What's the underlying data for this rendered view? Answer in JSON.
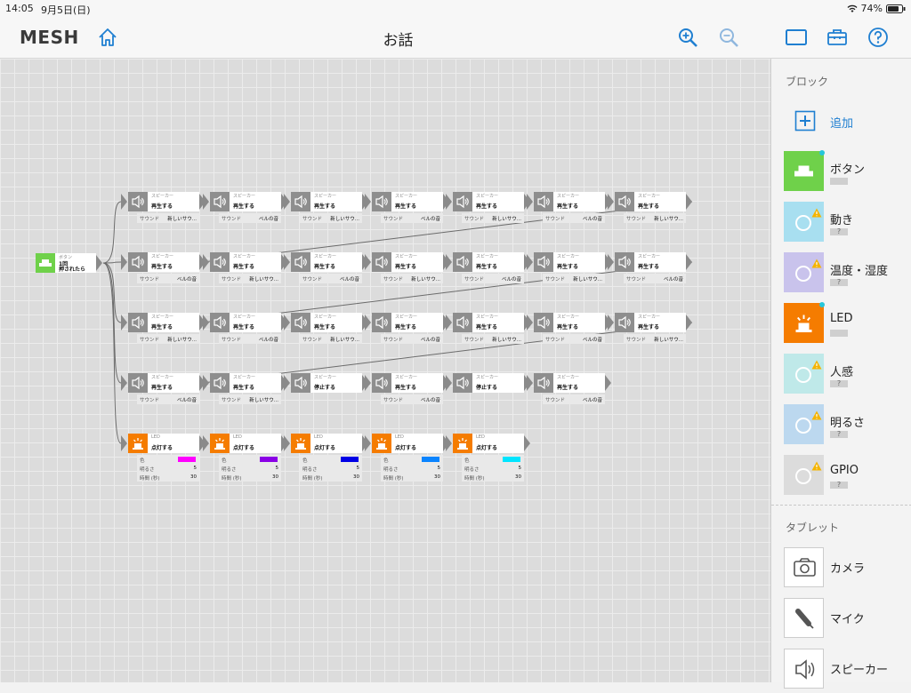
{
  "status": {
    "time": "14:05",
    "date": "9月5日(日)",
    "battery": "74%"
  },
  "topbar": {
    "logo": "MESH",
    "title": "お話",
    "icons": [
      "home-icon",
      "zoom-in-icon",
      "zoom-out-icon",
      "layout-icon",
      "toolbox-icon",
      "help-icon"
    ]
  },
  "sidebar": {
    "blocks_title": "ブロック",
    "add_label": "追加",
    "blocks": [
      {
        "label": "ボタン",
        "color": "#6fd14a",
        "connected": true,
        "warning": false,
        "sub": ""
      },
      {
        "label": "動き",
        "color": "#a8dff0",
        "connected": false,
        "warning": true,
        "sub": "?"
      },
      {
        "label": "温度・湿度",
        "color": "#c9c3ec",
        "connected": false,
        "warning": true,
        "sub": "?"
      },
      {
        "label": "LED",
        "color": "#f57c00",
        "connected": true,
        "warning": false,
        "sub": ""
      },
      {
        "label": "人感",
        "color": "#bfe9e9",
        "connected": false,
        "warning": true,
        "sub": "?"
      },
      {
        "label": "明るさ",
        "color": "#bcd8ef",
        "connected": false,
        "warning": true,
        "sub": "?"
      },
      {
        "label": "GPIO",
        "color": "#dcdcdc",
        "connected": false,
        "warning": true,
        "sub": "?"
      }
    ],
    "tablet_title": "タブレット",
    "tablet": [
      {
        "label": "カメラ",
        "icon": "camera-icon"
      },
      {
        "label": "マイク",
        "icon": "microphone-icon"
      },
      {
        "label": "スピーカー",
        "icon": "speaker-icon"
      }
    ]
  },
  "trigger": {
    "type": "ボタン",
    "action_line1": "1回",
    "action_line2": "押されたら"
  },
  "speaker_labels": {
    "type": "スピーカー",
    "prop": "サウンド"
  },
  "led_labels": {
    "type": "LED",
    "action": "点灯する",
    "color": "色",
    "brightness": "明るさ",
    "duration": "時間 (秒)",
    "brightness_value": "5",
    "duration_value": "30"
  },
  "rows": [
    [
      {
        "action": "再生する",
        "sound": "新しいサウ..."
      },
      {
        "action": "再生する",
        "sound": "ベルの音"
      },
      {
        "action": "再生する",
        "sound": "新しいサウ..."
      },
      {
        "action": "再生する",
        "sound": "ベルの音"
      },
      {
        "action": "再生する",
        "sound": "新しいサウ..."
      },
      {
        "action": "再生する",
        "sound": "ベルの音"
      },
      {
        "action": "再生する",
        "sound": "新しいサウ..."
      }
    ],
    [
      {
        "action": "再生する",
        "sound": "ベルの音"
      },
      {
        "action": "再生する",
        "sound": "新しいサウ..."
      },
      {
        "action": "再生する",
        "sound": "ベルの音"
      },
      {
        "action": "再生する",
        "sound": "新しいサウ..."
      },
      {
        "action": "再生する",
        "sound": "ベルの音"
      },
      {
        "action": "再生する",
        "sound": "新しいサウ..."
      },
      {
        "action": "再生する",
        "sound": "ベルの音"
      }
    ],
    [
      {
        "action": "再生する",
        "sound": "新しいサウ..."
      },
      {
        "action": "再生する",
        "sound": "ベルの音"
      },
      {
        "action": "再生する",
        "sound": "新しいサウ..."
      },
      {
        "action": "再生する",
        "sound": "ベルの音"
      },
      {
        "action": "再生する",
        "sound": "新しいサウ..."
      },
      {
        "action": "再生する",
        "sound": "ベルの音"
      },
      {
        "action": "再生する",
        "sound": "新しいサウ..."
      }
    ],
    [
      {
        "action": "再生する",
        "sound": "ベルの音"
      },
      {
        "action": "再生する",
        "sound": "新しいサウ..."
      },
      {
        "action": "停止する",
        "sound": ""
      },
      {
        "action": "再生する",
        "sound": "ベルの音"
      },
      {
        "action": "停止する",
        "sound": ""
      },
      {
        "action": "再生する",
        "sound": "ベルの音"
      }
    ]
  ],
  "led_row": [
    {
      "color_hex": "#ff00ff"
    },
    {
      "color_hex": "#8a00e6"
    },
    {
      "color_hex": "#0000e6"
    },
    {
      "color_hex": "#0a84ff"
    },
    {
      "color_hex": "#00e5ff"
    }
  ]
}
